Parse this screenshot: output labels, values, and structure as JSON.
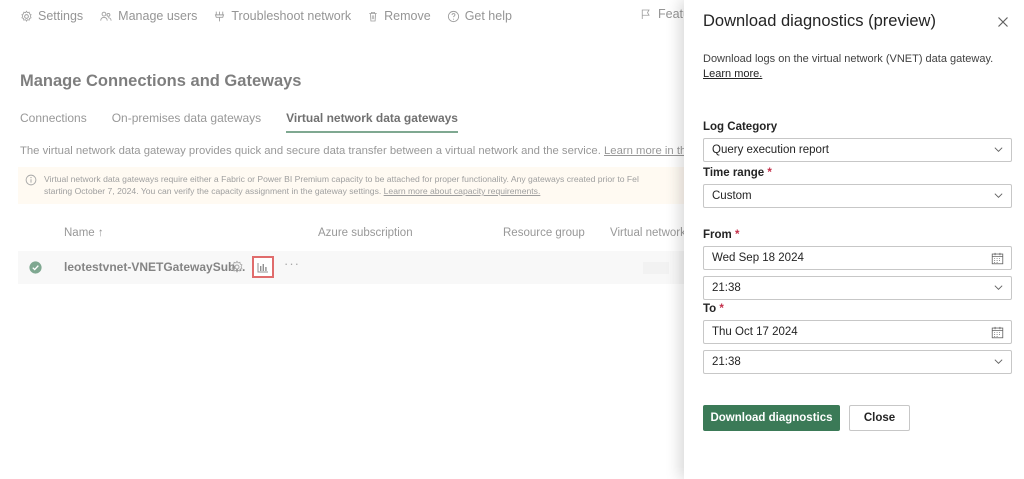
{
  "toolbar": {
    "settings": "Settings",
    "manage_users": "Manage users",
    "troubleshoot": "Troubleshoot network",
    "remove": "Remove",
    "get_help": "Get help",
    "feature": "Featu"
  },
  "page": {
    "title": "Manage Connections and Gateways",
    "tabs": [
      {
        "label": "Connections"
      },
      {
        "label": "On-premises data gateways"
      },
      {
        "label": "Virtual network data gateways"
      }
    ],
    "description": "The virtual network data gateway provides quick and secure data transfer between a virtual network and the service. ",
    "description_link": "Learn more in this over",
    "banner_line1": "Virtual network data gateways require either a Fabric or Power BI Premium capacity to be attached for proper functionality. Any gateways created prior to Fel",
    "banner_line2": "starting October 7, 2024. You can verify the capacity assignment in the gateway settings. ",
    "banner_link": "Learn more about capacity requirements."
  },
  "table": {
    "headers": {
      "name": "Name ↑",
      "azure_subscription": "Azure subscription",
      "resource_group": "Resource group",
      "virtual_network": "Virtual network"
    },
    "rows": [
      {
        "name": "leotestvnet-VNETGatewaySub..."
      }
    ]
  },
  "panel": {
    "title": "Download diagnostics (preview)",
    "description": "Download logs on the virtual network (VNET) data gateway. ",
    "description_link": "Learn more.",
    "log_category_label": "Log Category",
    "log_category_value": "Query execution report",
    "time_range_label": "Time range",
    "time_range_value": "Custom",
    "from_label": "From",
    "from_date": "Wed Sep 18 2024",
    "from_time": "21:38",
    "to_label": "To",
    "to_date": "Thu Oct 17 2024",
    "to_time": "21:38",
    "required_mark": "*",
    "download_button": "Download diagnostics",
    "close_button": "Close"
  },
  "colors": {
    "accent": "#3b7a57",
    "highlight_border": "#d01e1e",
    "banner_bg": "#fff8ec",
    "required": "#c4314b"
  },
  "icons": {
    "settings": "gear-icon",
    "manage_users": "people-icon",
    "troubleshoot": "network-icon",
    "remove": "trash-icon",
    "get_help": "question-icon",
    "feature": "flag-icon",
    "info": "info-icon",
    "status": "check-circle-icon",
    "diagnostics": "bar-chart-icon",
    "calendar": "calendar-icon",
    "dropdown": "chevron-down-icon",
    "close": "close-icon"
  }
}
